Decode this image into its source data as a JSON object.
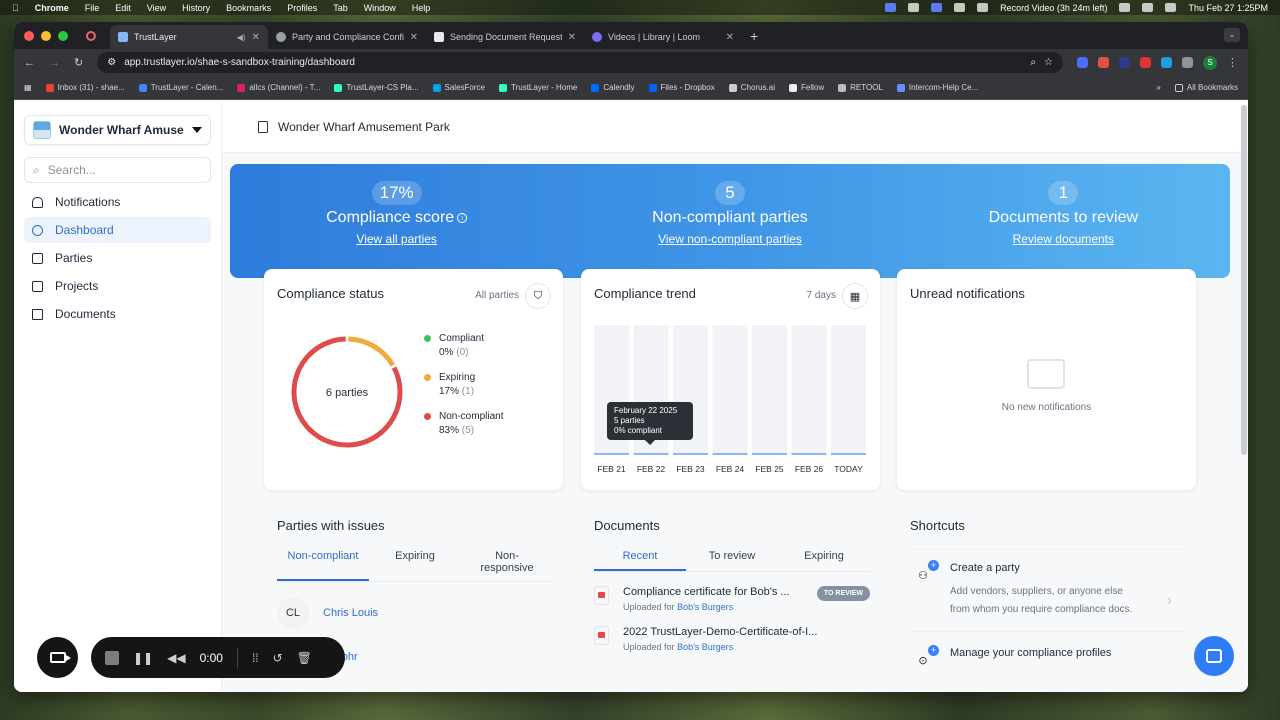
{
  "menubar": {
    "apple": "",
    "items": [
      "Chrome",
      "File",
      "Edit",
      "View",
      "History",
      "Bookmarks",
      "Profiles",
      "Tab",
      "Window",
      "Help"
    ],
    "record_label": "Record Video (3h 24m left)",
    "datetime": "Thu Feb 27  1:25PM"
  },
  "browser": {
    "tabs": [
      {
        "label": "TrustLayer",
        "active": true
      },
      {
        "label": "Party and Compliance Config",
        "active": false
      },
      {
        "label": "Sending Document Requests",
        "active": false
      },
      {
        "label": "Videos | Library | Loom",
        "active": false
      }
    ],
    "url": "app.trustlayer.io/shae-s-sandbox-training/dashboard",
    "bookmarks": [
      "Inbox (31) - shae...",
      "TrustLayer - Calen...",
      "allcs (Channel) - T...",
      "TrustLayer-CS Pla...",
      "SalesForce",
      "TrustLayer - Home",
      "Calendly",
      "Files - Dropbox",
      "Chorus.ai",
      "Fellow",
      "RETOOL",
      "Intercom-Help Ce..."
    ],
    "all_bookmarks": "All Bookmarks",
    "profile_initial": "S"
  },
  "sidebar": {
    "org_name": "Wonder Wharf Amuse...",
    "search_placeholder": "Search...",
    "items": [
      {
        "label": "Notifications",
        "icon": "bell-icon"
      },
      {
        "label": "Dashboard",
        "icon": "dashboard-icon",
        "active": true
      },
      {
        "label": "Parties",
        "icon": "parties-icon"
      },
      {
        "label": "Projects",
        "icon": "folder-icon"
      },
      {
        "label": "Documents",
        "icon": "document-icon"
      }
    ]
  },
  "header": {
    "title": "Wonder Wharf Amusement Park"
  },
  "kpis": [
    {
      "value": "17%",
      "title": "Compliance score",
      "link": "View all parties"
    },
    {
      "value": "5",
      "title": "Non-compliant parties",
      "link": "View non-compliant parties"
    },
    {
      "value": "1",
      "title": "Documents to review",
      "link": "Review documents"
    }
  ],
  "compliance_status": {
    "title": "Compliance status",
    "filter_label": "All parties",
    "center_label": "6 parties",
    "legend": [
      {
        "name": "Compliant",
        "pct": "0%",
        "count": "(0)",
        "color": "#3fbf5e"
      },
      {
        "name": "Expiring",
        "pct": "17%",
        "count": "(1)",
        "color": "#f2a93b"
      },
      {
        "name": "Non-compliant",
        "pct": "83%",
        "count": "(5)",
        "color": "#e04b4b"
      }
    ]
  },
  "compliance_trend": {
    "title": "Compliance trend",
    "range_label": "7 days",
    "tooltip": {
      "date": "February 22 2025",
      "parties": "5 parties",
      "compliant": "0% compliant"
    }
  },
  "notifications_card": {
    "title": "Unread notifications",
    "empty": "No new notifications"
  },
  "parties_issues": {
    "title": "Parties with issues",
    "tabs": [
      "Non-compliant",
      "Expiring",
      "Non-responsive"
    ],
    "rows": [
      {
        "initials": "CL",
        "name": "Chris Louis"
      },
      {
        "initials": "",
        "name": "Fohr"
      }
    ]
  },
  "documents": {
    "title": "Documents",
    "tabs": [
      "Recent",
      "To review",
      "Expiring"
    ],
    "uploaded_for": "Uploaded for",
    "rows": [
      {
        "title": "Compliance certificate for Bob's ...",
        "party": "Bob's Burgers",
        "badge": "TO REVIEW"
      },
      {
        "title": "2022 TrustLayer-Demo-Certificate-of-I...",
        "party": "Bob's Burgers",
        "badge": ""
      }
    ]
  },
  "shortcuts": {
    "title": "Shortcuts",
    "items": [
      {
        "title": "Create a party",
        "desc": "Add vendors, suppliers, or anyone else from whom you require compliance docs."
      },
      {
        "title": "Manage your compliance profiles",
        "desc": ""
      }
    ]
  },
  "recorder": {
    "time": "0:00"
  },
  "chart_data": {
    "type": "bar",
    "categories": [
      "FEB 21",
      "FEB 22",
      "FEB 23",
      "FEB 24",
      "FEB 25",
      "FEB 26",
      "TODAY"
    ],
    "values": [
      0,
      0,
      0,
      0,
      0,
      0,
      0
    ],
    "ylim": [
      0,
      100
    ],
    "ylabel": "",
    "xlabel": ""
  },
  "donut_data": {
    "type": "pie",
    "categories": [
      "Compliant",
      "Expiring",
      "Non-compliant"
    ],
    "values": [
      0,
      17,
      83
    ]
  }
}
